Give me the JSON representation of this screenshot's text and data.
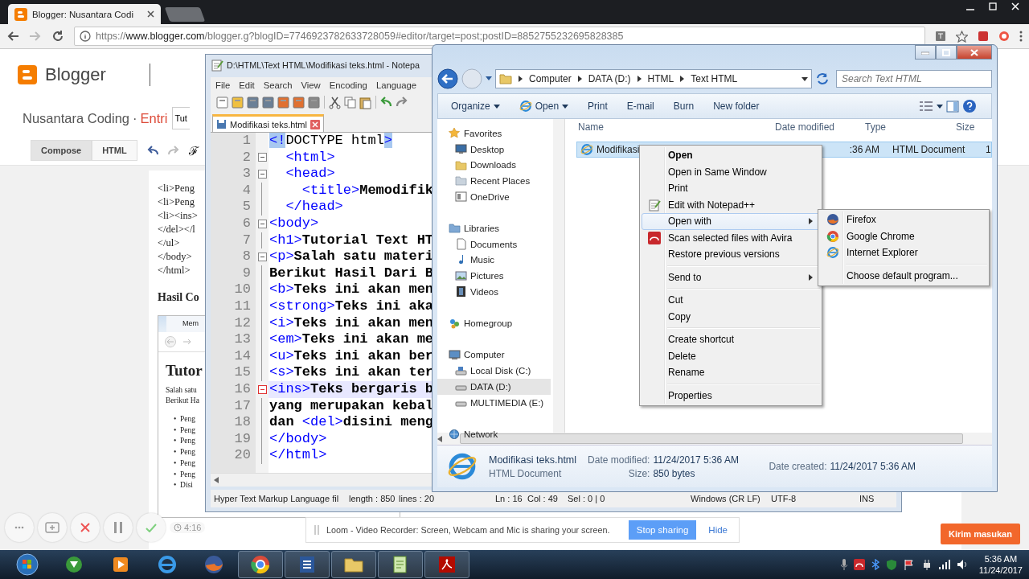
{
  "browser": {
    "tab_title": "Blogger: Nusantara Codi",
    "url": {
      "scheme": "https://",
      "host": "www.blogger.com",
      "path": "/blogger.g?blogID=7746923782633728059#editor/target=post;postID=8852755232695828385"
    }
  },
  "blogger": {
    "brand": "Blogger",
    "blog_name": "Nusantara Coding",
    "separator": "·",
    "section": "Entri",
    "post_title": "Tut",
    "modes": [
      {
        "label": "Compose",
        "selected": true
      },
      {
        "label": "HTML",
        "selected": false
      }
    ],
    "font_button": "ℱ",
    "editor_lines": [
      "<li>Peng",
      "<li>Peng",
      "<li><ins>",
      "</del></l",
      "</ul>",
      "</body>",
      "</html>"
    ],
    "heading": "Hasil Co",
    "preview": {
      "tab": "Mem",
      "title": "Tutor",
      "paragraph_lines": [
        "Salah satu",
        "Berikut Ha"
      ],
      "bullet_marker": "•",
      "bullets": [
        "Peng",
        "Peng",
        "Peng",
        "Peng",
        "Peng",
        "Peng",
        "Disi"
      ]
    }
  },
  "notepad": {
    "title": "D:\\HTML\\Text HTML\\Modifikasi teks.html - Notepa",
    "menu": [
      "File",
      "Edit",
      "Search",
      "View",
      "Encoding",
      "Language"
    ],
    "tab": "Modifikasi teks.html",
    "lines": [
      {
        "number": "1",
        "fold": false,
        "current": false,
        "segments": [
          {
            "kind": "bracket",
            "text": "<!"
          },
          {
            "kind": "plain",
            "text": "DOCTYPE html"
          },
          {
            "kind": "bracket",
            "text": ">"
          }
        ]
      },
      {
        "number": "2",
        "fold": true,
        "current": false,
        "segments": [
          {
            "kind": "tag",
            "text": "  <html>"
          }
        ]
      },
      {
        "number": "3",
        "fold": true,
        "current": false,
        "segments": [
          {
            "kind": "tag",
            "text": "  <head>"
          }
        ]
      },
      {
        "number": "4",
        "fold": false,
        "current": false,
        "segments": [
          {
            "kind": "tag",
            "text": "    <title>"
          },
          {
            "kind": "text",
            "text": "Memodifik"
          }
        ]
      },
      {
        "number": "5",
        "fold": false,
        "current": false,
        "segments": [
          {
            "kind": "tag",
            "text": "  </head>"
          }
        ]
      },
      {
        "number": "6",
        "fold": true,
        "current": false,
        "segments": [
          {
            "kind": "tag",
            "text": "<body>"
          }
        ]
      },
      {
        "number": "7",
        "fold": false,
        "current": false,
        "segments": [
          {
            "kind": "tag",
            "text": "<h1>"
          },
          {
            "kind": "text",
            "text": "Tutorial Text HT"
          }
        ]
      },
      {
        "number": "8",
        "fold": true,
        "current": false,
        "segments": [
          {
            "kind": "tag",
            "text": "<p>"
          },
          {
            "kind": "text",
            "text": "Salah satu materi"
          }
        ]
      },
      {
        "number": "9",
        "fold": false,
        "current": false,
        "segments": [
          {
            "kind": "text",
            "text": "Berikut Hasil Dari B"
          }
        ]
      },
      {
        "number": "10",
        "fold": false,
        "current": false,
        "segments": [
          {
            "kind": "tag",
            "text": "<b>"
          },
          {
            "kind": "text",
            "text": "Teks ini akan men"
          }
        ]
      },
      {
        "number": "11",
        "fold": false,
        "current": false,
        "segments": [
          {
            "kind": "tag",
            "text": "<strong>"
          },
          {
            "kind": "text",
            "text": "Teks ini aka"
          }
        ]
      },
      {
        "number": "12",
        "fold": false,
        "current": false,
        "segments": [
          {
            "kind": "tag",
            "text": "<i>"
          },
          {
            "kind": "text",
            "text": "Teks ini akan men"
          }
        ]
      },
      {
        "number": "13",
        "fold": false,
        "current": false,
        "segments": [
          {
            "kind": "tag",
            "text": "<em>"
          },
          {
            "kind": "text",
            "text": "Teks ini akan me"
          }
        ]
      },
      {
        "number": "14",
        "fold": false,
        "current": false,
        "segments": [
          {
            "kind": "tag",
            "text": "<u>"
          },
          {
            "kind": "text",
            "text": "Teks ini akan ber"
          }
        ]
      },
      {
        "number": "15",
        "fold": false,
        "current": false,
        "segments": [
          {
            "kind": "tag",
            "text": "<s>"
          },
          {
            "kind": "text",
            "text": "Teks ini akan ter"
          }
        ]
      },
      {
        "number": "16",
        "fold": true,
        "current": true,
        "segments": [
          {
            "kind": "tag",
            "text": "<ins>"
          },
          {
            "kind": "text",
            "text": "Teks bergaris b"
          }
        ]
      },
      {
        "number": "17",
        "fold": false,
        "current": false,
        "segments": [
          {
            "kind": "text",
            "text": "yang merupakan kebal"
          }
        ]
      },
      {
        "number": "18",
        "fold": false,
        "current": false,
        "segments": [
          {
            "kind": "text",
            "text": "dan "
          },
          {
            "kind": "tag",
            "text": "<del>"
          },
          {
            "kind": "text",
            "text": "disini meng"
          }
        ]
      },
      {
        "number": "19",
        "fold": false,
        "current": false,
        "segments": [
          {
            "kind": "tag",
            "text": "</body>"
          }
        ]
      },
      {
        "number": "20",
        "fold": false,
        "current": false,
        "segments": [
          {
            "kind": "tag",
            "text": "</html>"
          }
        ]
      }
    ],
    "status": [
      "Hyper Text Markup Language fil",
      "length : 850",
      "lines : 20",
      "Ln : 16",
      "Col : 49",
      "Sel : 0 | 0",
      "Windows (CR LF)",
      "UTF-8",
      "INS"
    ]
  },
  "explorer": {
    "address": [
      "Computer",
      "DATA (D:)",
      "HTML",
      "Text HTML"
    ],
    "search_placeholder": "Search Text HTML",
    "toolbar": [
      {
        "label": "Organize",
        "menu": true
      },
      {
        "label": "Open",
        "menu": true
      },
      {
        "label": "Print",
        "menu": false
      },
      {
        "label": "E-mail",
        "menu": false
      },
      {
        "label": "Burn",
        "menu": false
      },
      {
        "label": "New folder",
        "menu": false
      }
    ],
    "nav": [
      {
        "label": "Favorites",
        "selected": false,
        "children": [
          {
            "label": "Desktop",
            "selected": false
          },
          {
            "label": "Downloads",
            "selected": false
          },
          {
            "label": "Recent Places",
            "selected": false
          },
          {
            "label": "OneDrive",
            "selected": false
          }
        ]
      },
      {
        "label": "Libraries",
        "selected": false,
        "children": [
          {
            "label": "Documents",
            "selected": false
          },
          {
            "label": "Music",
            "selected": false
          },
          {
            "label": "Pictures",
            "selected": false
          },
          {
            "label": "Videos",
            "selected": false
          }
        ]
      },
      {
        "label": "Homegroup",
        "selected": false
      },
      {
        "label": "Computer",
        "selected": false,
        "children": [
          {
            "label": "Local Disk (C:)",
            "selected": false
          },
          {
            "label": "DATA (D:)",
            "selected": true
          },
          {
            "label": "MULTIMEDIA (E:)",
            "selected": false
          }
        ]
      },
      {
        "label": "Network",
        "selected": false
      }
    ],
    "columns": [
      "Name",
      "Date modified",
      "Type",
      "Size"
    ],
    "files": [
      {
        "name": "Modifikasi",
        "date_modified": ":36 AM",
        "type": "HTML Document",
        "size": "1",
        "selected": true
      }
    ],
    "details": {
      "name": "Modifikasi teks.html",
      "type": "HTML Document",
      "modified_label": "Date modified:",
      "modified": "11/24/2017 5:36 AM",
      "size_label": "Size:",
      "size": "850 bytes",
      "created_label": "Date created:",
      "created": "11/24/2017 5:36 AM"
    }
  },
  "context_menu": [
    {
      "kind": "item",
      "label": "Open",
      "default": true,
      "highlighted": false,
      "submenu": false
    },
    {
      "kind": "item",
      "label": "Open in Same Window",
      "default": false,
      "highlighted": false,
      "submenu": false
    },
    {
      "kind": "item",
      "label": "Print",
      "default": false,
      "highlighted": false,
      "submenu": false
    },
    {
      "kind": "item",
      "label": "Edit with Notepad++",
      "default": false,
      "highlighted": false,
      "submenu": false
    },
    {
      "kind": "item",
      "label": "Open with",
      "default": false,
      "highlighted": true,
      "submenu": true
    },
    {
      "kind": "item",
      "label": "Scan selected files with Avira",
      "default": false,
      "highlighted": false,
      "submenu": false
    },
    {
      "kind": "item",
      "label": "Restore previous versions",
      "default": false,
      "highlighted": false,
      "submenu": false
    },
    {
      "kind": "separator"
    },
    {
      "kind": "item",
      "label": "Send to",
      "default": false,
      "highlighted": false,
      "submenu": true
    },
    {
      "kind": "separator"
    },
    {
      "kind": "item",
      "label": "Cut",
      "default": false,
      "highlighted": false,
      "submenu": false
    },
    {
      "kind": "item",
      "label": "Copy",
      "default": false,
      "highlighted": false,
      "submenu": false
    },
    {
      "kind": "separator"
    },
    {
      "kind": "item",
      "label": "Create shortcut",
      "default": false,
      "highlighted": false,
      "submenu": false
    },
    {
      "kind": "item",
      "label": "Delete",
      "default": false,
      "highlighted": false,
      "submenu": false
    },
    {
      "kind": "item",
      "label": "Rename",
      "default": false,
      "highlighted": false,
      "submenu": false
    },
    {
      "kind": "separator"
    },
    {
      "kind": "item",
      "label": "Properties",
      "default": false,
      "highlighted": false,
      "submenu": false
    }
  ],
  "submenu": [
    {
      "kind": "item",
      "label": "Firefox"
    },
    {
      "kind": "item",
      "label": "Google Chrome"
    },
    {
      "kind": "item",
      "label": "Internet Explorer"
    },
    {
      "kind": "separator"
    },
    {
      "kind": "item",
      "label": "Choose default program..."
    }
  ],
  "loom": {
    "timer": "4:16",
    "message": "Loom - Video Recorder: Screen, Webcam and Mic is sharing your screen.",
    "stop": "Stop sharing",
    "hide": "Hide"
  },
  "feedback_button": "Kirim masukan",
  "taskbar": {
    "apps": [
      {
        "running": false
      },
      {
        "running": false
      },
      {
        "running": false
      },
      {
        "running": false
      },
      {
        "running": true
      },
      {
        "running": true
      },
      {
        "running": true
      },
      {
        "running": true
      },
      {
        "running": true
      }
    ],
    "time": "5:36 AM",
    "date": "11/24/2017"
  }
}
